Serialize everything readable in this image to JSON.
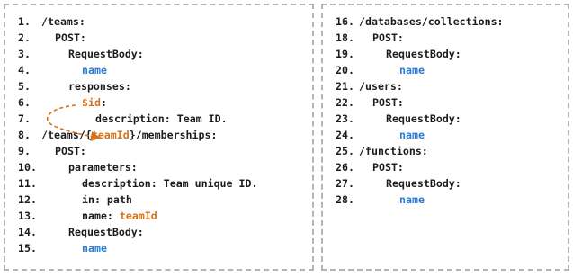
{
  "left": {
    "lines": [
      {
        "num": "1.",
        "indent": 0,
        "segments": [
          {
            "text": "/teams:",
            "color": "dark"
          }
        ]
      },
      {
        "num": "2.",
        "indent": 1,
        "segments": [
          {
            "text": "POST:",
            "color": "dark"
          }
        ]
      },
      {
        "num": "3.",
        "indent": 2,
        "segments": [
          {
            "text": "RequestBody:",
            "color": "dark"
          }
        ]
      },
      {
        "num": "4.",
        "indent": 3,
        "segments": [
          {
            "text": "name",
            "color": "blue"
          }
        ]
      },
      {
        "num": "5.",
        "indent": 2,
        "segments": [
          {
            "text": "responses:",
            "color": "dark"
          }
        ]
      },
      {
        "num": "6.",
        "indent": 3,
        "segments": [
          {
            "text": "$id",
            "color": "orange"
          },
          {
            "text": ":",
            "color": "dark"
          }
        ]
      },
      {
        "num": "7.",
        "indent": 4,
        "segments": [
          {
            "text": "description: Team ID.",
            "color": "dark"
          }
        ]
      },
      {
        "num": "8.",
        "indent": 0,
        "segments": [
          {
            "text": "/teams/{",
            "color": "dark"
          },
          {
            "text": "teamId",
            "color": "orange"
          },
          {
            "text": "}/memberships:",
            "color": "dark"
          }
        ]
      },
      {
        "num": "9.",
        "indent": 1,
        "segments": [
          {
            "text": "POST:",
            "color": "dark"
          }
        ]
      },
      {
        "num": "10.",
        "indent": 2,
        "segments": [
          {
            "text": "parameters:",
            "color": "dark"
          }
        ]
      },
      {
        "num": "11.",
        "indent": 3,
        "segments": [
          {
            "text": "description: Team unique ID.",
            "color": "dark"
          }
        ]
      },
      {
        "num": "12.",
        "indent": 3,
        "segments": [
          {
            "text": "in: path",
            "color": "dark"
          }
        ]
      },
      {
        "num": "13.",
        "indent": 3,
        "segments": [
          {
            "text": "name: ",
            "color": "dark"
          },
          {
            "text": "teamId",
            "color": "orange"
          }
        ]
      },
      {
        "num": "14.",
        "indent": 2,
        "segments": [
          {
            "text": "RequestBody:",
            "color": "dark"
          }
        ]
      },
      {
        "num": "15.",
        "indent": 3,
        "segments": [
          {
            "text": "name",
            "color": "blue"
          }
        ]
      }
    ]
  },
  "right": {
    "lines": [
      {
        "num": "16.",
        "indent": 0,
        "segments": [
          {
            "text": "/databases/collections:",
            "color": "dark"
          }
        ]
      },
      {
        "num": "18.",
        "indent": 1,
        "segments": [
          {
            "text": "POST:",
            "color": "dark"
          }
        ]
      },
      {
        "num": "19.",
        "indent": 2,
        "segments": [
          {
            "text": "RequestBody:",
            "color": "dark"
          }
        ]
      },
      {
        "num": "20.",
        "indent": 3,
        "segments": [
          {
            "text": "name",
            "color": "blue"
          }
        ]
      },
      {
        "num": "21.",
        "indent": 0,
        "segments": [
          {
            "text": "/users:",
            "color": "dark"
          }
        ]
      },
      {
        "num": "22.",
        "indent": 1,
        "segments": [
          {
            "text": "POST:",
            "color": "dark"
          }
        ]
      },
      {
        "num": "23.",
        "indent": 2,
        "segments": [
          {
            "text": "RequestBody:",
            "color": "dark"
          }
        ]
      },
      {
        "num": "24.",
        "indent": 3,
        "segments": [
          {
            "text": "name",
            "color": "blue"
          }
        ]
      },
      {
        "num": "25.",
        "indent": 0,
        "segments": [
          {
            "text": "/functions:",
            "color": "dark"
          }
        ]
      },
      {
        "num": "26.",
        "indent": 1,
        "segments": [
          {
            "text": "POST:",
            "color": "dark"
          }
        ]
      },
      {
        "num": "27.",
        "indent": 2,
        "segments": [
          {
            "text": "RequestBody:",
            "color": "dark"
          }
        ]
      },
      {
        "num": "28.",
        "indent": 3,
        "segments": [
          {
            "text": "name",
            "color": "blue"
          }
        ]
      }
    ]
  },
  "colors": {
    "dark": "#1c1c1c",
    "blue": "#2b7bd6",
    "orange": "#d4721c",
    "border": "#b5b5b5"
  },
  "annotation": {
    "type": "dashed-arrow",
    "from_line": "6.",
    "to_line": "8.",
    "color": "#d4721c"
  }
}
